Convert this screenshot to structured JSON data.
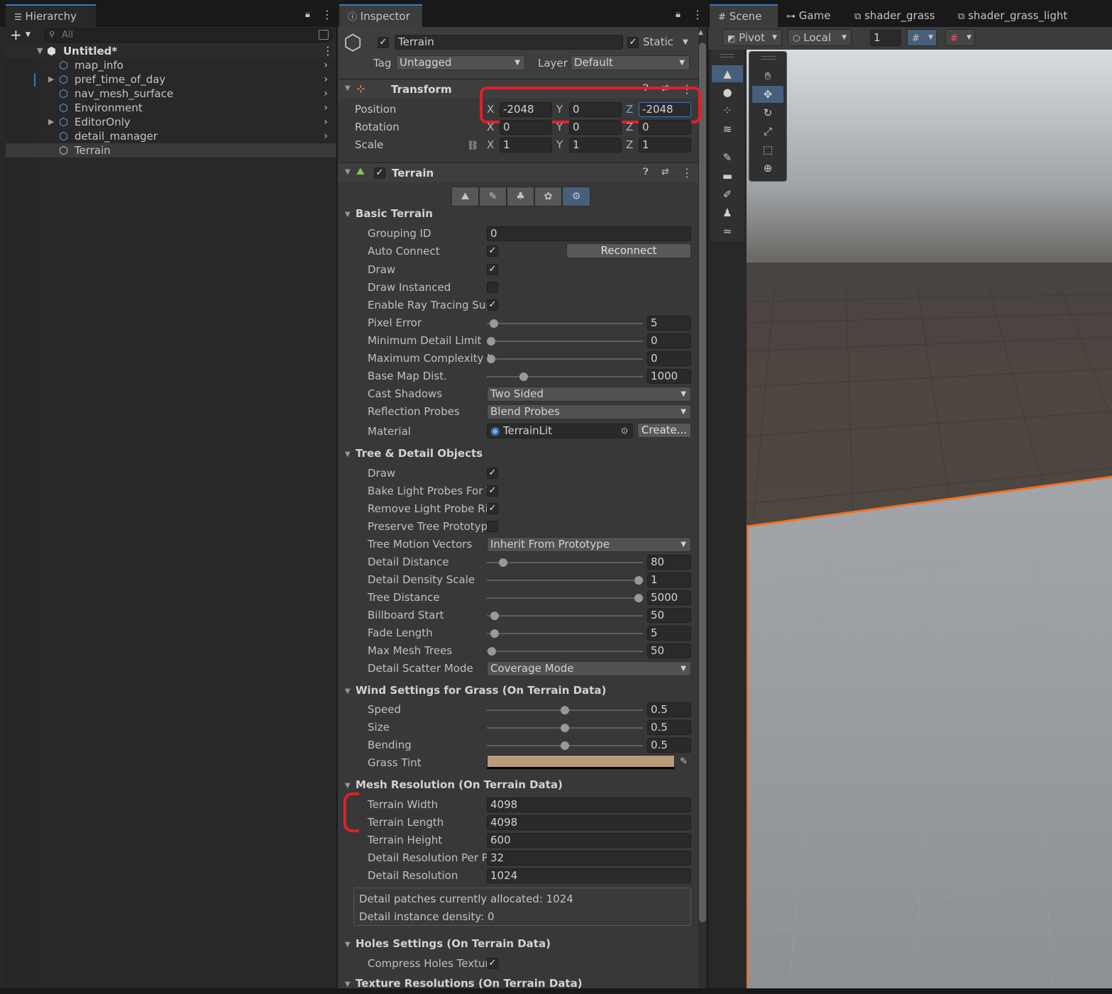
{
  "hierarchy": {
    "tab_label": "Hierarchy",
    "search_placeholder": "All",
    "scene_name": "Untitled*",
    "items": [
      {
        "label": "map_info",
        "prefab": true,
        "expandable": false
      },
      {
        "label": "pref_time_of_day",
        "prefab": true,
        "expandable": true
      },
      {
        "label": "nav_mesh_surface",
        "prefab": true,
        "expandable": false
      },
      {
        "label": "Environment",
        "prefab": true,
        "expandable": false
      },
      {
        "label": "EditorOnly",
        "prefab": true,
        "expandable": true
      },
      {
        "label": "detail_manager",
        "prefab": true,
        "expandable": false
      },
      {
        "label": "Terrain",
        "prefab": false,
        "expandable": false,
        "selected": true
      }
    ]
  },
  "inspector": {
    "tab_label": "Inspector",
    "object_name": "Terrain",
    "static_label": "Static",
    "tag_label": "Tag",
    "tag_value": "Untagged",
    "layer_label": "Layer",
    "layer_value": "Default",
    "transform": {
      "title": "Transform",
      "position_label": "Position",
      "rotation_label": "Rotation",
      "scale_label": "Scale",
      "axis_x": "X",
      "axis_y": "Y",
      "axis_z": "Z",
      "position": [
        "-2048",
        "0",
        "-2048"
      ],
      "rotation": [
        "0",
        "0",
        "0"
      ],
      "scale": [
        "1",
        "1",
        "1"
      ]
    },
    "terrain": {
      "title": "Terrain",
      "basic": {
        "title": "Basic Terrain",
        "grouping_id_label": "Grouping ID",
        "grouping_id": "0",
        "auto_connect_label": "Auto Connect",
        "reconnect_label": "Reconnect",
        "draw_label": "Draw",
        "draw_instanced_label": "Draw Instanced",
        "ray_tracing_label": "Enable Ray Tracing Sup",
        "pixel_error_label": "Pixel Error",
        "pixel_error": "5",
        "min_detail_label": "Minimum Detail Limit",
        "min_detail": "0",
        "max_complexity_label": "Maximum Complexity L",
        "max_complexity": "0",
        "base_map_label": "Base Map Dist.",
        "base_map": "1000",
        "cast_shadows_label": "Cast Shadows",
        "cast_shadows": "Two Sided",
        "reflection_label": "Reflection Probes",
        "reflection": "Blend Probes",
        "material_label": "Material",
        "material": "TerrainLit",
        "create_label": "Create..."
      },
      "tree": {
        "title": "Tree & Detail Objects",
        "draw_label": "Draw",
        "bake_label": "Bake Light Probes For T",
        "remove_label": "Remove Light Probe Rir",
        "preserve_label": "Preserve Tree Prototyp",
        "motion_label": "Tree Motion Vectors",
        "motion": "Inherit From Prototype",
        "detail_distance_label": "Detail Distance",
        "detail_distance": "80",
        "density_label": "Detail Density Scale",
        "density": "1",
        "tree_distance_label": "Tree Distance",
        "tree_distance": "5000",
        "billboard_label": "Billboard Start",
        "billboard": "50",
        "fade_label": "Fade Length",
        "fade": "5",
        "max_mesh_label": "Max Mesh Trees",
        "max_mesh": "50",
        "scatter_label": "Detail Scatter Mode",
        "scatter": "Coverage Mode"
      },
      "wind": {
        "title": "Wind Settings for Grass (On Terrain Data)",
        "speed_label": "Speed",
        "speed": "0.5",
        "size_label": "Size",
        "size": "0.5",
        "bending_label": "Bending",
        "bending": "0.5",
        "tint_label": "Grass Tint",
        "tint_color": "#b89a7c"
      },
      "mesh": {
        "title": "Mesh Resolution (On Terrain Data)",
        "width_label": "Terrain Width",
        "width": "4098",
        "length_label": "Terrain Length",
        "length": "4098",
        "height_label": "Terrain Height",
        "height": "600",
        "detail_per_label": "Detail Resolution Per Pa",
        "detail_per": "32",
        "detail_res_label": "Detail Resolution",
        "detail_res": "1024",
        "info_line1": "Detail patches currently allocated: 1024",
        "info_line2": "Detail instance density: 0"
      },
      "holes": {
        "title": "Holes Settings (On Terrain Data)",
        "compress_label": "Compress Holes Textur"
      },
      "texture_title": "Texture Resolutions (On Terrain Data)"
    }
  },
  "scene": {
    "tabs": [
      "Scene",
      "Game",
      "shader_grass",
      "shader_grass_light"
    ],
    "pivot_label": "Pivot",
    "local_label": "Local",
    "snap_value": "1"
  },
  "colors": {
    "accent": "#3a79bb",
    "prefab_text": "#6fa6e7",
    "annotation_red": "#e0202a",
    "terrain_edge": "#f07020"
  }
}
